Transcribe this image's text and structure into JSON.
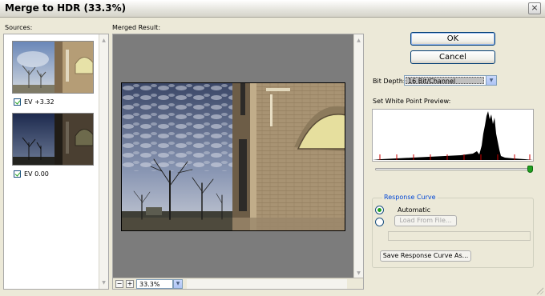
{
  "window": {
    "title": "Merge to HDR (33.3%)"
  },
  "sources": {
    "label": "Sources:",
    "items": [
      {
        "ev": "EV +3.32",
        "checked": true
      },
      {
        "ev": "EV 0.00",
        "checked": true
      }
    ]
  },
  "merged": {
    "label": "Merged Result:",
    "zoom_value": "33.3%",
    "zoom_out": "−",
    "zoom_in": "+"
  },
  "buttons": {
    "ok": "OK",
    "cancel": "Cancel"
  },
  "bit_depth": {
    "label": "Bit Depth:",
    "value": "16 Bit/Channel"
  },
  "white_point": {
    "label": "Set White Point Preview:",
    "slider_value": 1.0
  },
  "response_curve": {
    "legend": "Response Curve",
    "automatic": "Automatic",
    "load_button": "Load From File...",
    "save_button": "Save Response Curve As...",
    "selected": "Automatic"
  },
  "icons": {
    "close": "close-icon",
    "dropdown": "chevron-down-icon",
    "scroll_up": "scroll-up-icon",
    "scroll_down": "scroll-down-icon"
  },
  "colors": {
    "accent": "#0046d5",
    "check": "#21a121",
    "histogram": "#000000",
    "tick": "#cc0000"
  }
}
